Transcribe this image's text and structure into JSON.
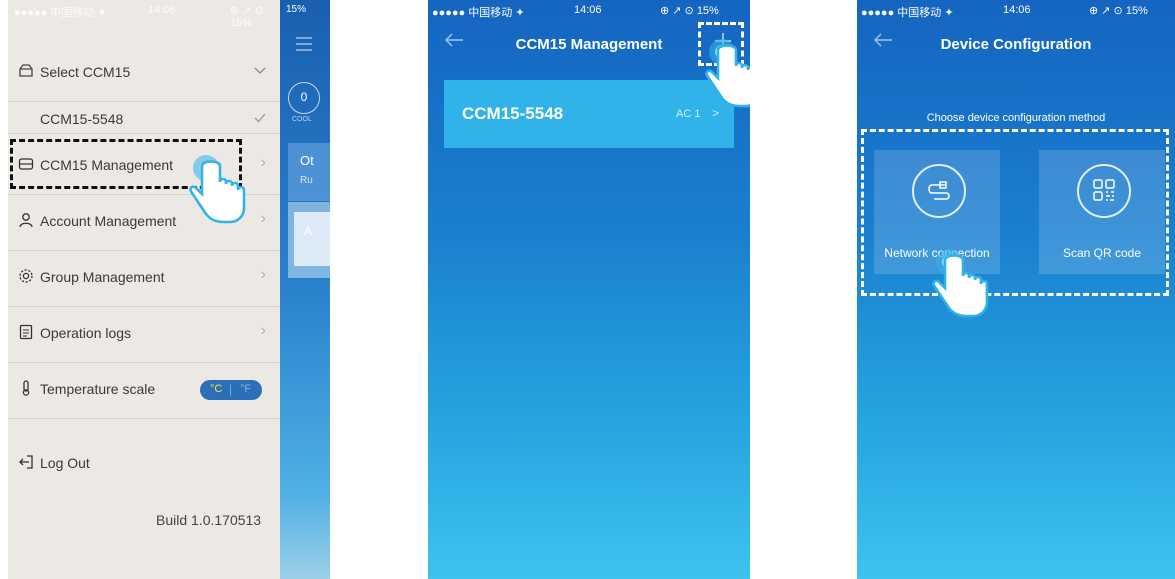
{
  "status": {
    "carrier": "●●●●● 中国移动 ✦",
    "time": "14:06",
    "battery": "⊕ ↗ ⊙ 15%"
  },
  "panel1": {
    "strip_battery": "15%",
    "strip_badge": "0",
    "strip_cool": "COOL",
    "strip_text_1": "Ot",
    "strip_text_2": "Ru",
    "strip_text_3": "A",
    "items": [
      {
        "label": "Select CCM15"
      },
      {
        "label": "CCM15-5548"
      },
      {
        "label": "CCM15 Management"
      },
      {
        "label": "Account Management"
      },
      {
        "label": "Group Management"
      },
      {
        "label": "Operation logs"
      },
      {
        "label": "Temperature scale"
      },
      {
        "label": "Log Out"
      }
    ],
    "toggle_c": "°C",
    "toggle_f": "°F",
    "build": "Build 1.0.170513"
  },
  "panel2": {
    "title": "CCM15 Management",
    "device_name": "CCM15-5548",
    "device_sub": "AC 1",
    "device_chev": ">"
  },
  "panel3": {
    "title": "Device Configuration",
    "prompt": "Choose device configuration method",
    "option_network": "Network connection",
    "option_scan": "Scan QR code"
  },
  "colors": {
    "accent": "#2fb3e8",
    "menu_bg": "#ece8e4",
    "toggle": "#2a6fb8",
    "highlight": "#f2e43a"
  }
}
